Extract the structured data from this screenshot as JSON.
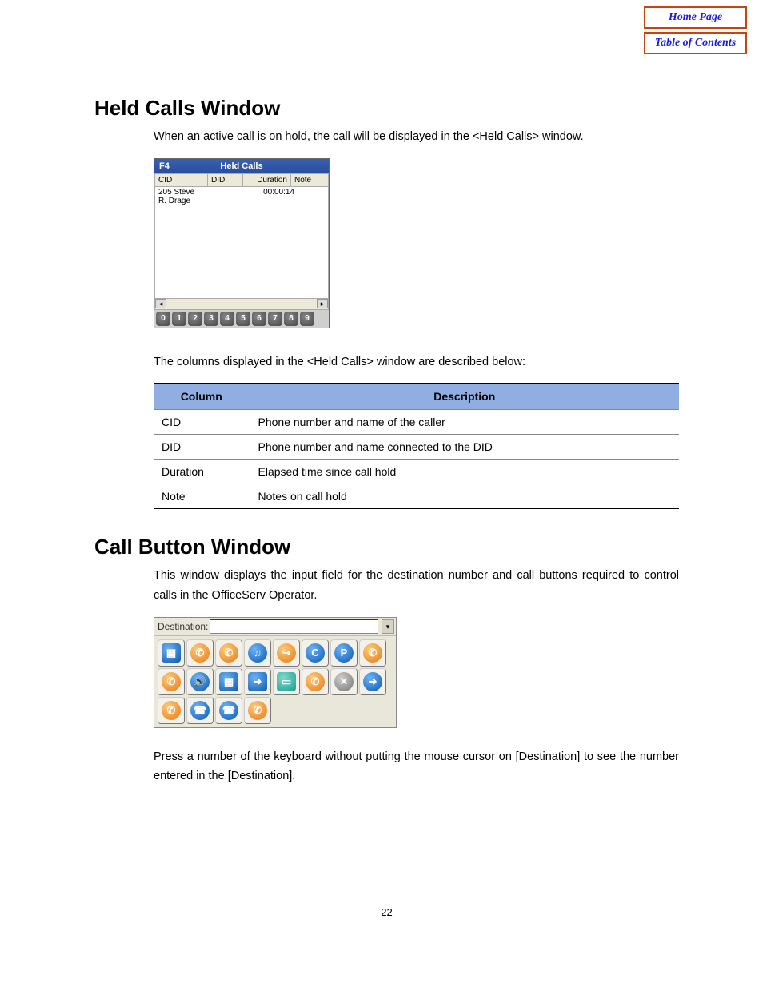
{
  "nav": {
    "home": "Home Page",
    "toc": "Table of Contents"
  },
  "section1": {
    "title": "Held Calls Window",
    "intro": "When an active call is on hold, the call will be displayed in the <Held Calls> window.",
    "after_figure": "The columns displayed in the <Held Calls> window are described below:"
  },
  "held_window": {
    "key": "F4",
    "title": "Held Calls",
    "columns": {
      "cid": "CID",
      "did": "DID",
      "duration": "Duration",
      "note": "Note"
    },
    "row": {
      "cid_line1": "205 Steve",
      "cid_line2": "R. Drage",
      "did": "",
      "duration": "00:00:14",
      "note": ""
    },
    "digits": [
      "0",
      "1",
      "2",
      "3",
      "4",
      "5",
      "6",
      "7",
      "8",
      "9"
    ]
  },
  "desc_table": {
    "headers": {
      "column": "Column",
      "description": "Description"
    },
    "rows": [
      {
        "col": "CID",
        "desc": "Phone number and name of the caller"
      },
      {
        "col": "DID",
        "desc": "Phone number and name connected to the DID"
      },
      {
        "col": "Duration",
        "desc": "Elapsed time since call hold"
      },
      {
        "col": "Note",
        "desc": "Notes on call hold"
      }
    ]
  },
  "section2": {
    "title": "Call Button Window",
    "intro": "This window displays the input field for the destination number and call buttons required to control calls in the OfficeServ Operator.",
    "after_figure": "Press a number of the keyboard without putting the mouse cursor on [Destination] to see the number entered in the [Destination]."
  },
  "call_window": {
    "dest_label": "Destination:",
    "buttons": [
      {
        "name": "status-icon",
        "glyph": "▦",
        "cls": "blue square"
      },
      {
        "name": "answer-icon",
        "glyph": "✆",
        "cls": "orange"
      },
      {
        "name": "dial-icon",
        "glyph": "✆",
        "cls": "orange"
      },
      {
        "name": "hold-music-icon",
        "glyph": "♫",
        "cls": "blue"
      },
      {
        "name": "transfer-icon",
        "glyph": "↪",
        "cls": "orange"
      },
      {
        "name": "camp-icon",
        "glyph": "C",
        "cls": "blue"
      },
      {
        "name": "park-icon",
        "glyph": "P",
        "cls": "blue"
      },
      {
        "name": "page-icon",
        "glyph": "✆",
        "cls": "orange"
      },
      {
        "name": "mute-icon",
        "glyph": "✆",
        "cls": "orange"
      },
      {
        "name": "speaker-icon",
        "glyph": "🔊",
        "cls": "blue"
      },
      {
        "name": "conference-icon",
        "glyph": "▦",
        "cls": "blue square"
      },
      {
        "name": "forward-icon",
        "glyph": "➜",
        "cls": "blue square"
      },
      {
        "name": "card-icon",
        "glyph": "▭",
        "cls": "teal square"
      },
      {
        "name": "record-icon",
        "glyph": "✆",
        "cls": "orange"
      },
      {
        "name": "cancel-icon",
        "glyph": "✕",
        "cls": "gray"
      },
      {
        "name": "next-icon",
        "glyph": "➜",
        "cls": "blue"
      },
      {
        "name": "redial-icon",
        "glyph": "✆",
        "cls": "orange"
      },
      {
        "name": "end-icon",
        "glyph": "☎",
        "cls": "blue"
      },
      {
        "name": "hangup-icon",
        "glyph": "☎",
        "cls": "blue"
      },
      {
        "name": "pickup-icon",
        "glyph": "✆",
        "cls": "orange"
      }
    ]
  },
  "page_number": "22"
}
